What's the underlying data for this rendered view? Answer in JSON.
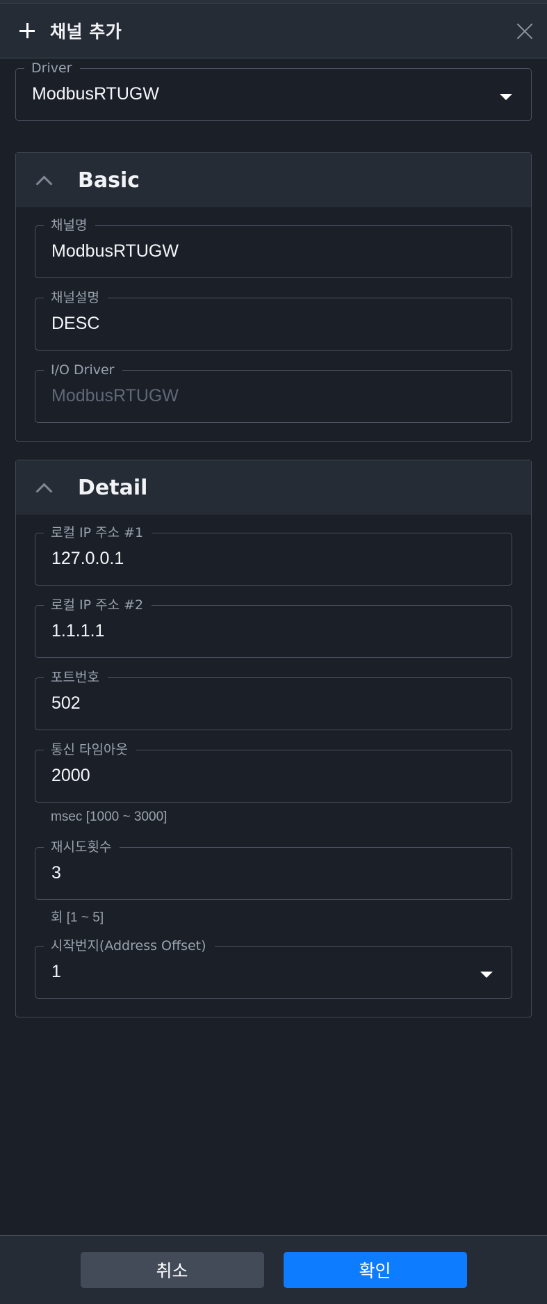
{
  "header": {
    "title": "채널 추가",
    "plus_icon": "plus-icon",
    "close_icon": "close-icon"
  },
  "driver": {
    "label": "Driver",
    "value": "ModbusRTUGW"
  },
  "basic": {
    "title": "Basic",
    "fields": [
      {
        "label": "채널명",
        "value": "ModbusRTUGW"
      },
      {
        "label": "채널설명",
        "value": "DESC"
      },
      {
        "label": "I/O Driver",
        "value": "ModbusRTUGW",
        "disabled": true
      }
    ]
  },
  "detail": {
    "title": "Detail",
    "local_ip1": {
      "label": "로컬 IP 주소 #1",
      "value": "127.0.0.1"
    },
    "local_ip2": {
      "label": "로컬 IP 주소 #2",
      "value": "1.1.1.1"
    },
    "port": {
      "label": "포트번호",
      "value": "502"
    },
    "timeout": {
      "label": "통신 타임아웃",
      "value": "2000",
      "help": "msec [1000 ~ 3000]"
    },
    "retry": {
      "label": "재시도횟수",
      "value": "3",
      "help": "회 [1 ~ 5]"
    },
    "offset": {
      "label": "시작번지(Address Offset)",
      "value": "1"
    }
  },
  "footer": {
    "cancel_label": "취소",
    "ok_label": "확인"
  },
  "colors": {
    "primary": "#0d7cff",
    "cancel": "#434b59",
    "background": "#1b1f27",
    "panel": "#262c35"
  }
}
